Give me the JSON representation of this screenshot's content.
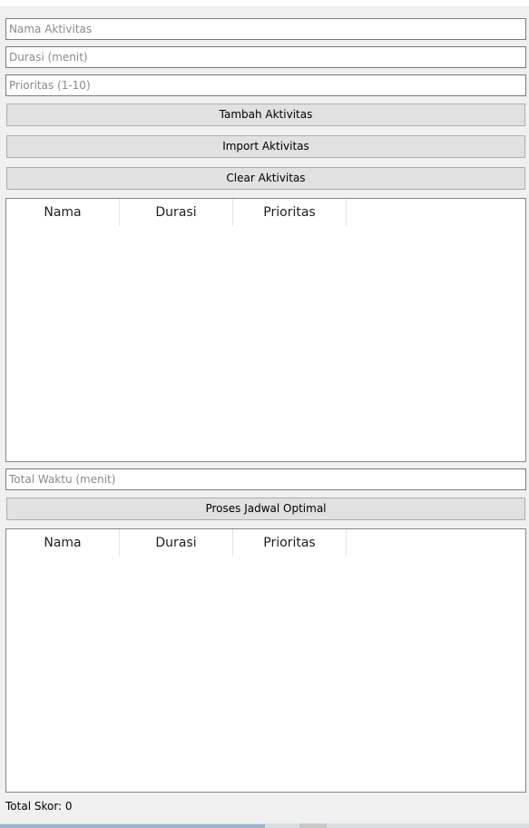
{
  "inputs": {
    "nama_aktivitas": {
      "value": "",
      "placeholder": "Nama Aktivitas"
    },
    "durasi": {
      "value": "",
      "placeholder": "Durasi (menit)"
    },
    "prioritas": {
      "value": "",
      "placeholder": "Prioritas (1-10)"
    },
    "total_waktu": {
      "value": "",
      "placeholder": "Total Waktu (menit)"
    }
  },
  "buttons": {
    "tambah": "Tambah Aktivitas",
    "import": "Import Aktivitas",
    "clear": "Clear Aktivitas",
    "proses": "Proses Jadwal Optimal"
  },
  "activity_table": {
    "columns": [
      "Nama",
      "Durasi",
      "Prioritas"
    ],
    "rows": []
  },
  "result_table": {
    "columns": [
      "Nama",
      "Durasi",
      "Prioritas"
    ],
    "rows": []
  },
  "status": {
    "total_skor": "Total Skor: 0"
  }
}
